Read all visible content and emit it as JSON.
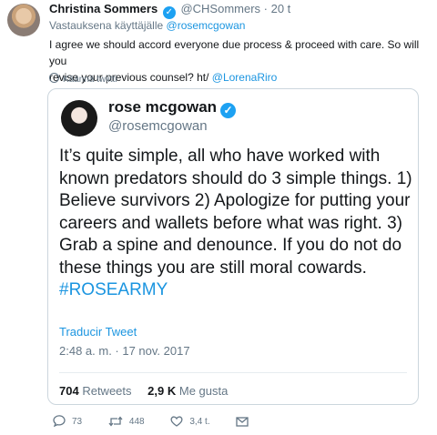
{
  "author": {
    "name": "Christina Sommers",
    "handle": "@CHSommers",
    "time": "· 20 t"
  },
  "reply_to": {
    "prefix": "Vastauksena käyttäjälle",
    "handle": "@rosemcgowan"
  },
  "tweet": {
    "text_line1": "I agree we should accord everyone due process & proceed with care.  So will you",
    "text_line2": "revise your previous counsel?  ht/",
    "mention": "@LorenaRiro",
    "translate": "Käännä twiitti"
  },
  "quoted": {
    "name": "rose mcgowan",
    "handle": "@rosemcgowan",
    "text": "It’s quite simple, all who have worked with known predators should do 3 simple things. 1) Believe survivors 2) Apologize for putting your careers and wallets before what was right. 3) Grab a spine and denounce. If you do not do these things you are still moral cowards.",
    "hashtag": "#ROSEARMY",
    "translate": "Traducir Tweet",
    "date": "2:48 a. m. · 17 nov. 2017",
    "retweets_count": "704",
    "retweets_label": "Retweets",
    "likes_count": "2,9 K",
    "likes_label": "Me gusta"
  },
  "actions": {
    "replies": "73",
    "retweets": "448",
    "likes": "3,4 t."
  },
  "colors": {
    "link": "#1b95e0",
    "verified": "#1da1f2",
    "muted": "#657786"
  }
}
